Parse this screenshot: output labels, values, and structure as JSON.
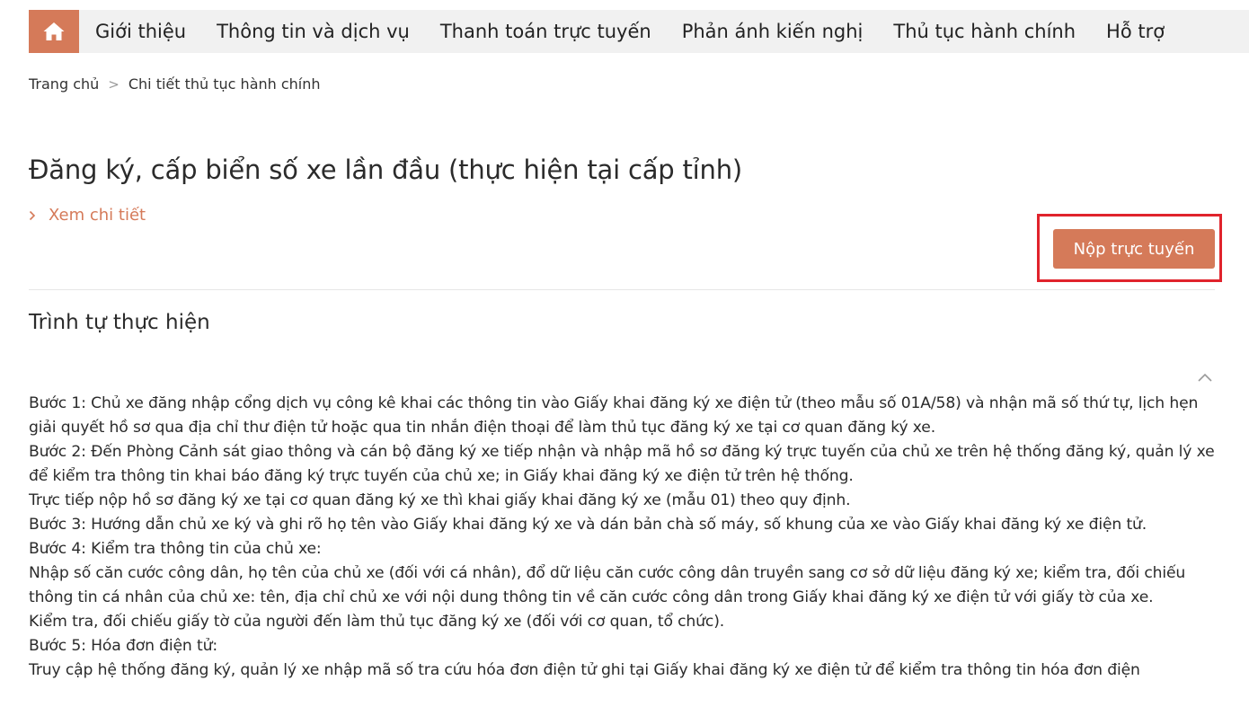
{
  "nav": {
    "home_icon": "home-icon",
    "items": [
      "Giới thiệu",
      "Thông tin và dịch vụ",
      "Thanh toán trực tuyến",
      "Phản ánh kiến nghị",
      "Thủ tục hành chính",
      "Hỗ trợ"
    ]
  },
  "breadcrumb": {
    "home": "Trang chủ",
    "separator": ">",
    "current": "Chi tiết thủ tục hành chính"
  },
  "procedure": {
    "title": "Đăng ký, cấp biển số xe lần đầu (thực hiện tại cấp tỉnh)",
    "detail_link": "Xem chi tiết",
    "submit_label": "Nộp trực tuyến"
  },
  "section": {
    "title": "Trình tự thực hiện",
    "lines": [
      "Bước 1: Chủ xe đăng nhập cổng dịch vụ công kê khai các thông tin vào Giấy khai đăng ký xe điện tử (theo mẫu số 01A/58) và nhận mã số thứ tự, lịch hẹn giải quyết hồ sơ qua địa chỉ thư điện tử hoặc qua tin nhắn điện thoại để làm thủ tục đăng ký xe tại cơ quan đăng ký xe.",
      "Bước 2: Đến Phòng Cảnh sát giao thông và cán bộ đăng ký xe tiếp nhận và nhập mã hồ sơ đăng ký trực tuyến của chủ xe trên hệ thống đăng ký, quản lý xe để kiểm tra thông tin khai báo đăng ký trực tuyến của chủ xe; in Giấy khai đăng ký xe điện tử trên hệ thống.",
      "Trực tiếp nộp hồ sơ đăng ký xe tại cơ quan đăng ký xe thì khai giấy khai đăng ký xe (mẫu 01) theo quy định.",
      "Bước 3: Hướng dẫn chủ xe ký và ghi rõ họ tên vào Giấy khai đăng ký xe và dán bản chà số máy, số khung của xe vào Giấy khai đăng ký xe điện tử.",
      "Bước 4: Kiểm tra thông tin của chủ xe:",
      "Nhập số căn cước công dân, họ tên của chủ xe (đối với cá nhân), đổ dữ liệu căn cước công dân truyền sang cơ sở dữ liệu đăng ký xe; kiểm tra, đối chiếu thông tin cá nhân của chủ xe: tên, địa chỉ chủ xe với nội dung thông tin về căn cước công dân trong Giấy khai đăng ký xe điện tử với giấy tờ của xe.",
      "Kiểm tra, đối chiếu giấy tờ của người đến làm thủ tục đăng ký xe (đối với cơ quan, tổ chức).",
      "Bước 5: Hóa đơn điện tử:",
      "Truy cập hệ thống đăng ký, quản lý xe nhập mã số tra cứu hóa đơn điện tử ghi tại Giấy khai đăng ký xe điện tử để kiểm tra thông tin hóa đơn điện"
    ]
  },
  "colors": {
    "accent": "#d57a59",
    "nav_bg": "#f1f1f1",
    "highlight": "#e0232c"
  }
}
